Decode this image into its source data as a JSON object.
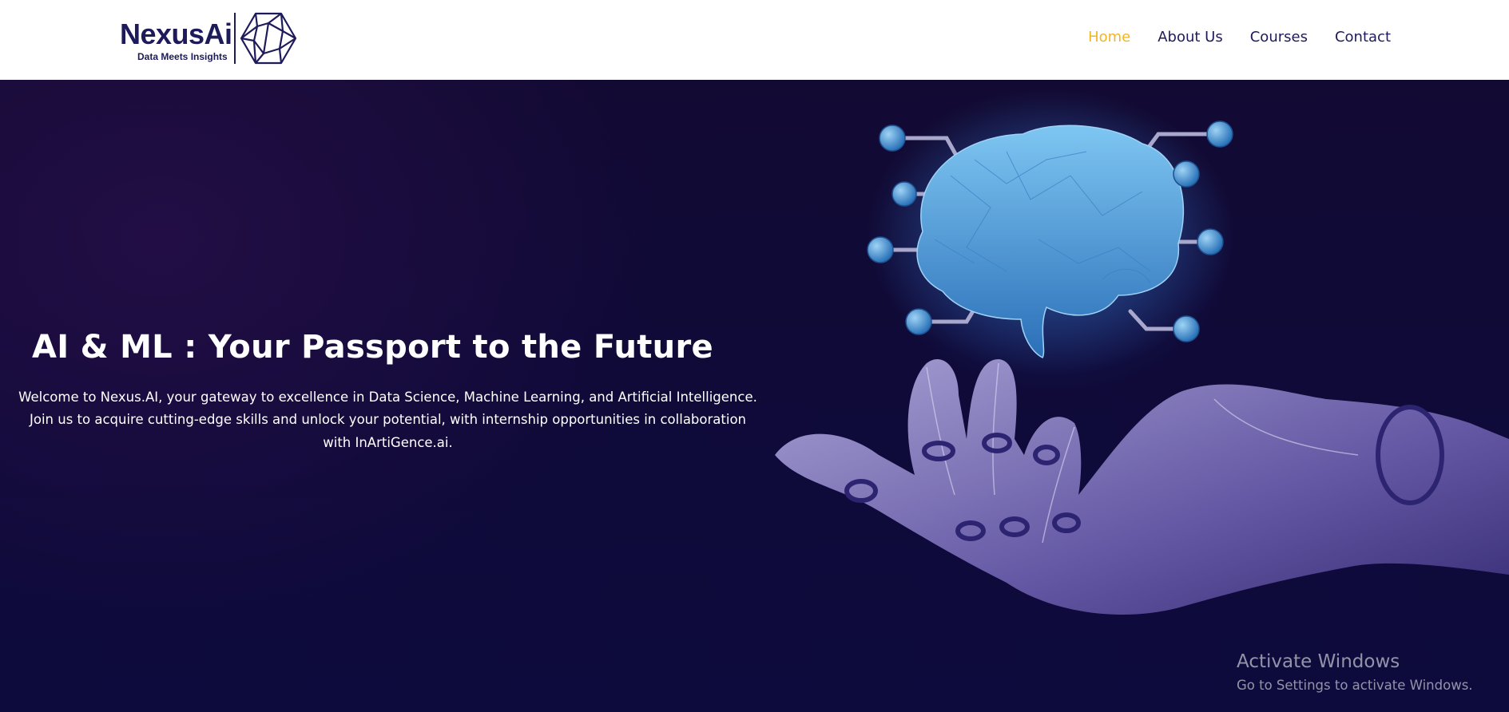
{
  "brand": {
    "name": "NexusAi",
    "tagline": "Data Meets Insights",
    "color": "#1e1b5a"
  },
  "nav": {
    "items": [
      {
        "label": "Home",
        "active": true
      },
      {
        "label": "About Us",
        "active": false
      },
      {
        "label": "Courses",
        "active": false
      },
      {
        "label": "Contact",
        "active": false
      }
    ],
    "active_color": "#f3b61f"
  },
  "hero": {
    "title": "AI & ML : Your Passport to the Future",
    "description": "Welcome to Nexus.AI, your gateway to excellence in Data Science, Machine Learning, and Artificial Intelligence. Join us to acquire cutting-edge skills and unlock your potential, with internship opportunities in collaboration with InArtiGence.ai.",
    "image": "robot-hand-holding-brain-illustration"
  },
  "os_watermark": {
    "title": "Activate Windows",
    "subtitle": "Go to Settings to activate Windows."
  }
}
